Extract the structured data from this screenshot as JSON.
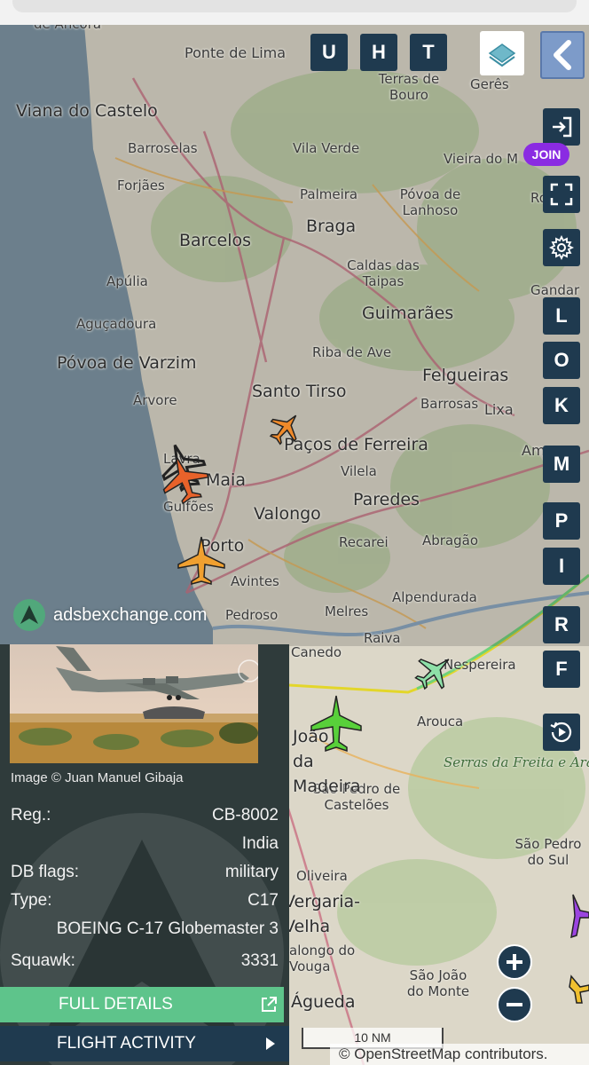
{
  "app": {
    "watermark": "adsbexchange.com",
    "join_badge": "JOIN"
  },
  "top_buttons": [
    "U",
    "H",
    "T"
  ],
  "side_buttons": [
    "L",
    "O",
    "K",
    "M",
    "P",
    "I",
    "R",
    "F"
  ],
  "map_labels": [
    "de Ancora",
    "Ponte de Lima",
    "Terras de Bouro",
    "Gerês",
    "Viana do Castelo",
    "Barroselas",
    "Vila Verde",
    "Vieira do M",
    "Forjães",
    "Palmeira",
    "Póvoa de Lanhoso",
    "Ross",
    "Barcelos",
    "Braga",
    "Apúlia",
    "Caldas das Taipas",
    "Gandar",
    "Aguçadoura",
    "Guimarães",
    "Póvoa de Varzim",
    "Riba de Ave",
    "Árvore",
    "Santo Tirso",
    "Felgueiras",
    "Barrosas",
    "Lixa",
    "Paços de Ferreira",
    "Amar",
    "Lavra",
    "Maia",
    "Vilela",
    "Guifões",
    "Valongo",
    "Paredes",
    "Porto",
    "Recarei",
    "Abragão",
    "Alpendurada",
    "Avintes",
    "Pedroso",
    "Melres",
    "Raiva",
    "Canedo",
    "Nespereira",
    "Arouca",
    "Serras da Freita e Arada",
    "São Pedro de Castelões",
    "São Pedro do Sul",
    "Oliveira",
    "Vergaria-Velha",
    "alongo do Vouga",
    "São João do Monte",
    "Águeda",
    "João da Madeira"
  ],
  "aircraft_panel": {
    "photo_credit": "Image © Juan Manuel Gibaja",
    "reg_label": "Reg.:",
    "reg_value": "CB-8002",
    "country": "India",
    "db_flags_label": "DB flags:",
    "db_flags_value": "military",
    "type_label": "Type:",
    "type_value": "C17",
    "model": "BOEING C-17 Globemaster 3",
    "squawk_label": "Squawk:",
    "squawk_value": "3331",
    "full_details": "FULL DETAILS",
    "flight_activity": "FLIGHT ACTIVITY"
  },
  "scale_bar": "10 NM",
  "attribution": "© OpenStreetMap contributors."
}
